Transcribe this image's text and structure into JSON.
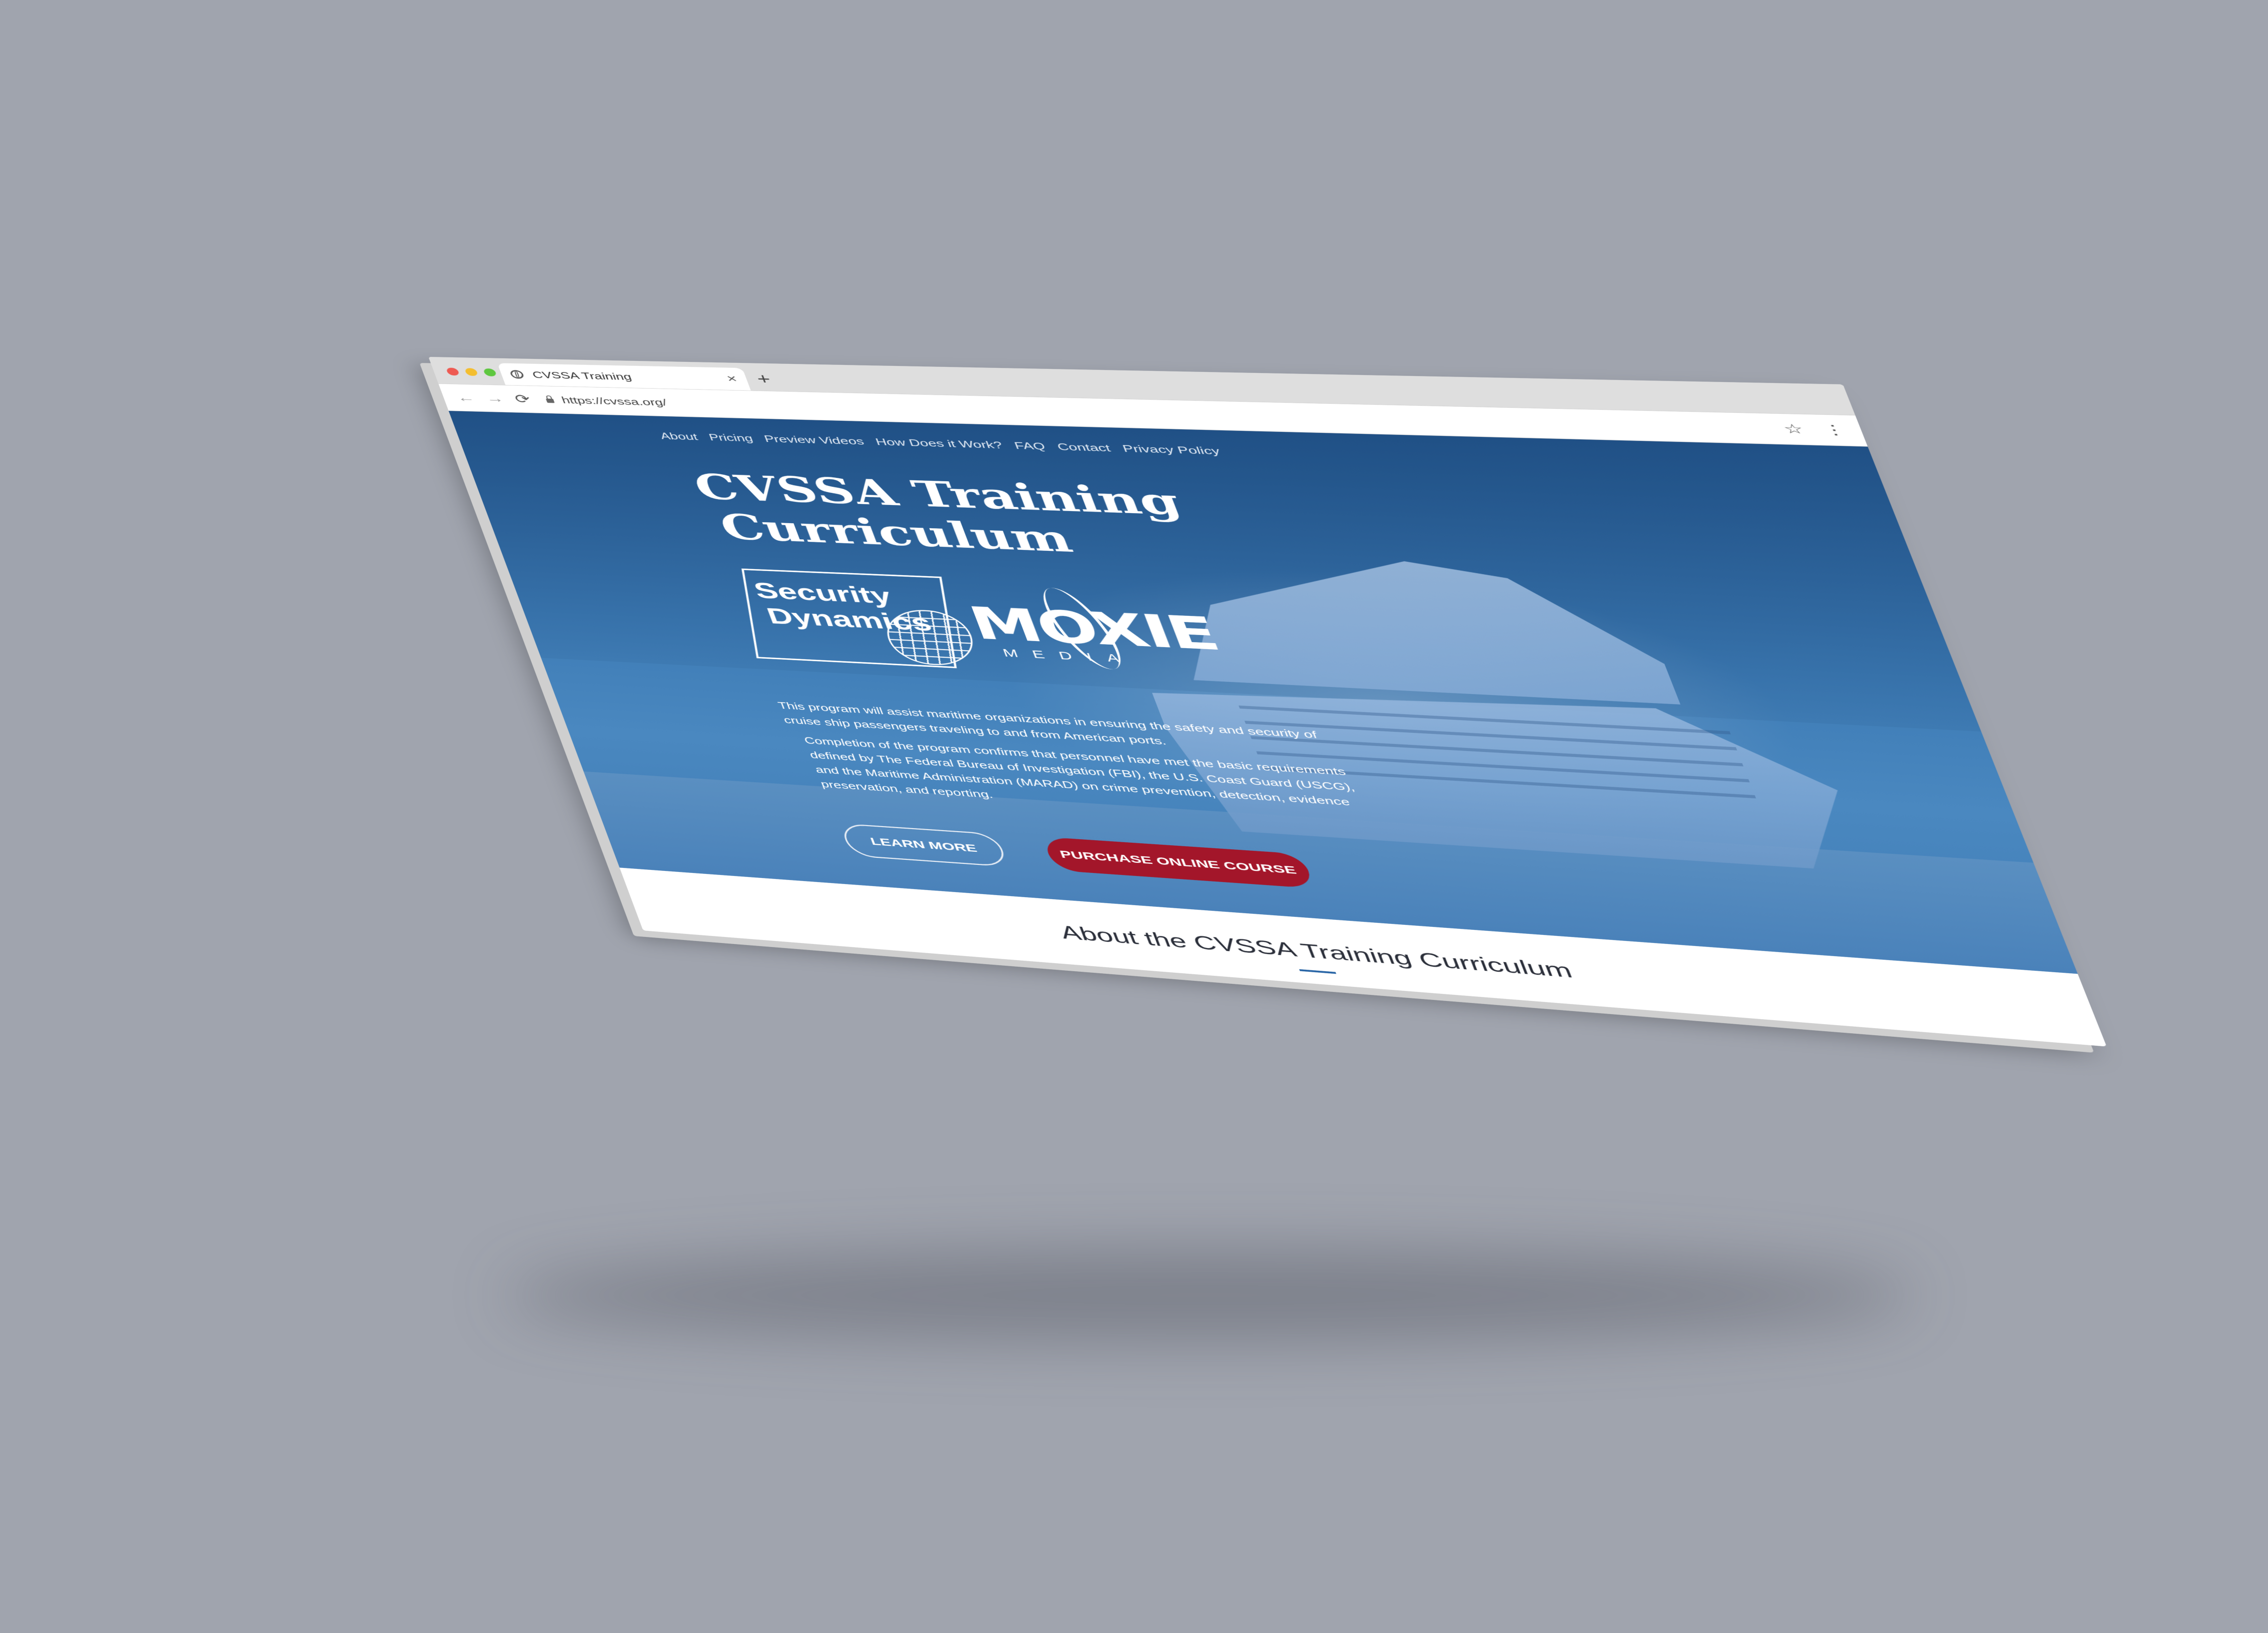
{
  "browser": {
    "tab_title": "CVSSA Training",
    "tab_close": "×",
    "new_tab": "+",
    "url": "https://cvssa.org/",
    "back": "←",
    "forward": "→",
    "reload": "⟳",
    "bookmark": "☆",
    "menu": "⋮"
  },
  "nav": {
    "items": [
      {
        "label": "About"
      },
      {
        "label": "Pricing"
      },
      {
        "label": "Preview Videos"
      },
      {
        "label": "How Does it Work?"
      },
      {
        "label": "FAQ"
      },
      {
        "label": "Contact"
      },
      {
        "label": "Privacy Policy"
      }
    ]
  },
  "hero": {
    "title_line1": "CVSSA Training",
    "title_line2": "Curriculum",
    "logo_security_dynamics_line1": "Security",
    "logo_security_dynamics_line2": "Dynamics",
    "logo_moxie_big": "MOXIE",
    "logo_moxie_small": "MEDIA",
    "paragraph1": "This program will assist maritime organizations in ensuring the safety and security of cruise ship passengers traveling to and from American ports.",
    "paragraph2": "Completion of the program confirms that personnel have met the basic requirements defined by The Federal Bureau of Investigation (FBI), the U.S. Coast Guard (USCG), and the Maritime Administration (MARAD) on crime prevention, detection, evidence preservation, and reporting.",
    "learn_more_label": "LEARN MORE",
    "purchase_label": "PURCHASE ONLINE COURSE"
  },
  "about": {
    "heading": "About the CVSSA Training Curriculum"
  },
  "colors": {
    "hero_blue": "#3d7bb5",
    "purchase_red": "#a3162a",
    "accent_bar": "#2b67a7",
    "background": "#a0a4ae"
  }
}
